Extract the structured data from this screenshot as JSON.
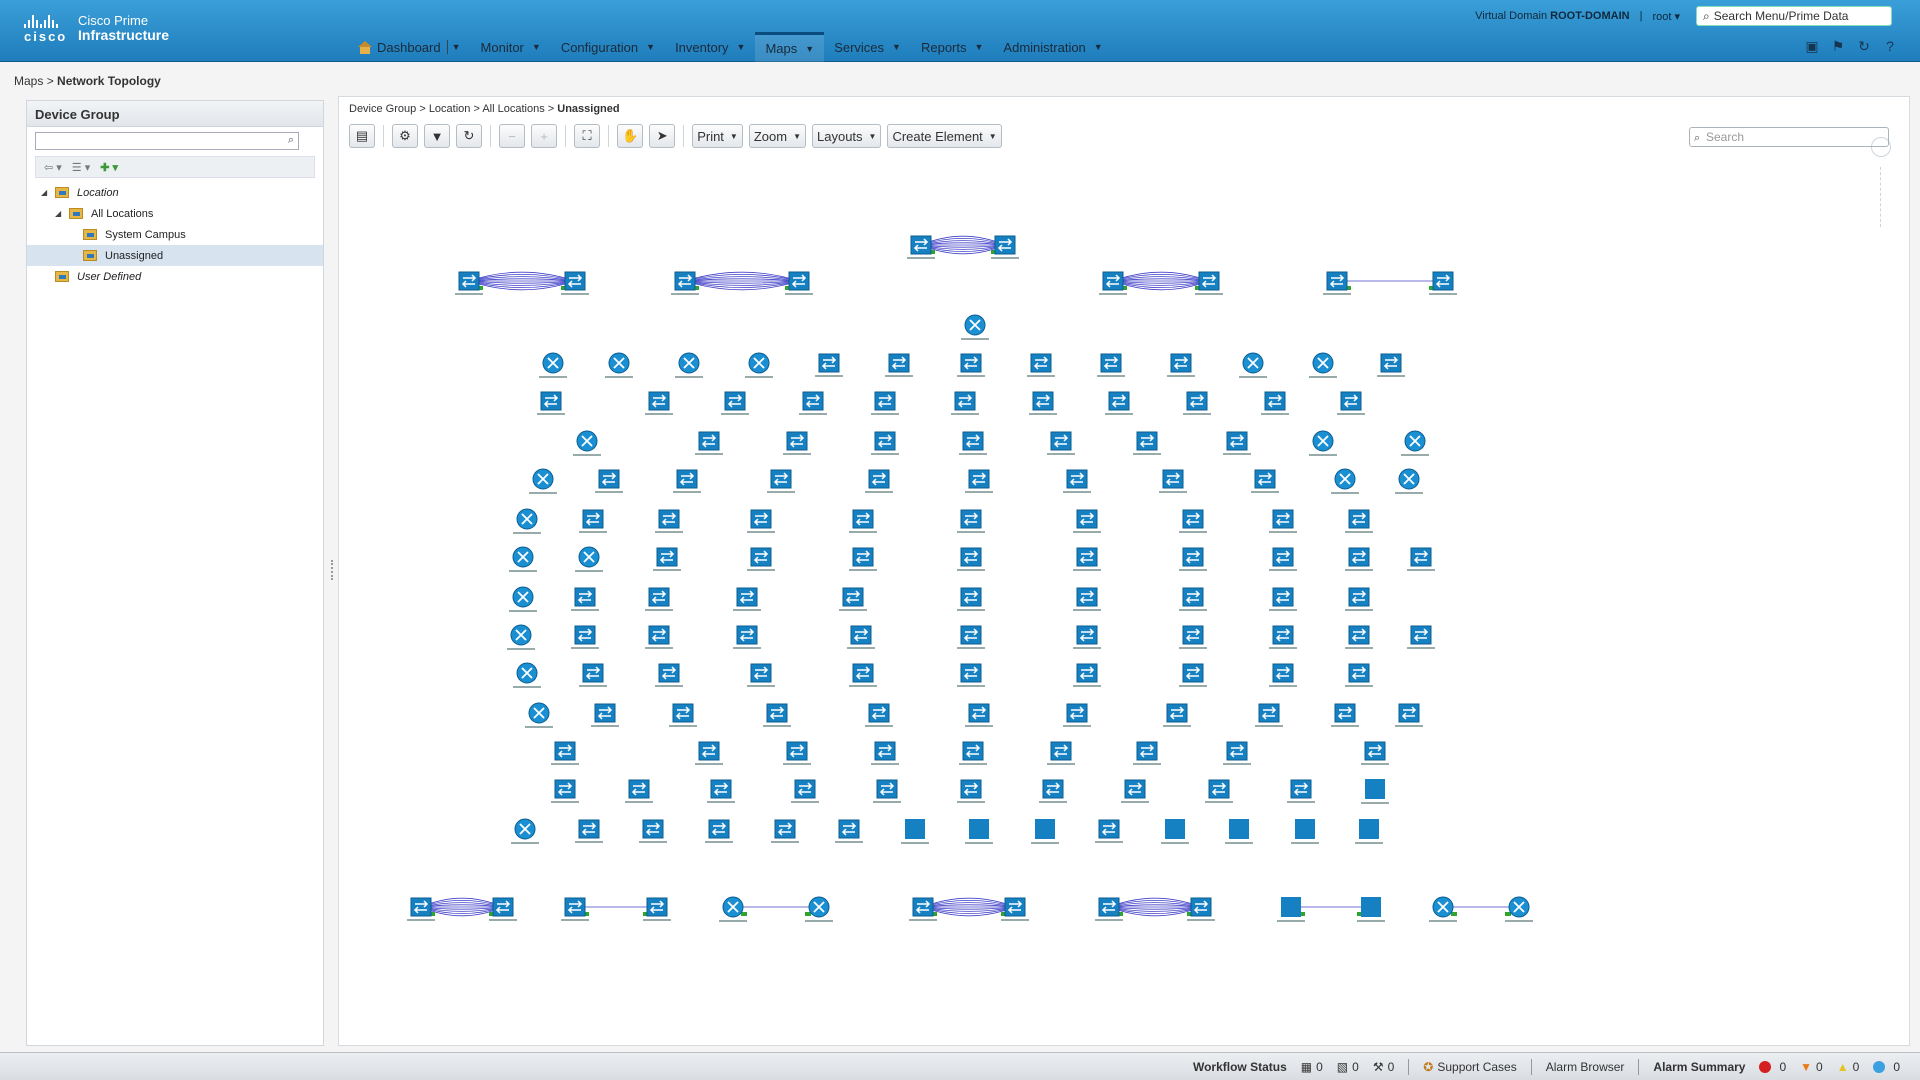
{
  "header": {
    "logo_text": "cisco",
    "product_line1": "Cisco Prime",
    "product_line2": "Infrastructure",
    "virtual_domain_label": "Virtual Domain",
    "virtual_domain_value": "ROOT-DOMAIN",
    "user": "root",
    "search_placeholder": "Search Menu/Prime Data"
  },
  "nav": [
    {
      "label": "Dashboard"
    },
    {
      "label": "Monitor"
    },
    {
      "label": "Configuration"
    },
    {
      "label": "Inventory"
    },
    {
      "label": "Maps"
    },
    {
      "label": "Services"
    },
    {
      "label": "Administration"
    },
    {
      "label": "Reports"
    }
  ],
  "breadcrumb": {
    "root": "Maps",
    "sep": ">",
    "current": "Network Topology"
  },
  "left_panel": {
    "title": "Device Group",
    "tree": [
      {
        "label": "Location"
      },
      {
        "label": "All Locations"
      },
      {
        "label": "System Campus"
      },
      {
        "label": "Unassigned"
      },
      {
        "label": "User Defined"
      }
    ]
  },
  "map": {
    "breadcrumb": [
      "Device Group",
      "Location",
      "All Locations",
      "Unassigned"
    ],
    "toolbar": {
      "print": "Print",
      "zoom": "Zoom",
      "layouts": "Layouts",
      "create": "Create Element"
    },
    "search_placeholder": "Search",
    "colors": {
      "switch": "#1581c2",
      "router": "#1a8fd1",
      "link": "#4040c8",
      "link_green": "#2fa52f"
    }
  },
  "statusbar": {
    "workflow": "Workflow Status",
    "counts": [
      "0",
      "0",
      "0"
    ],
    "support": "Support Cases",
    "alarm_browser": "Alarm Browser",
    "alarm_summary": "Alarm Summary",
    "alarm_counts": [
      "0",
      "0",
      "0",
      "0"
    ]
  }
}
